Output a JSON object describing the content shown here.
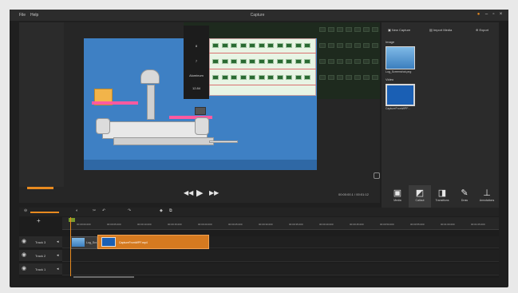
{
  "window": {
    "title": "Capture",
    "menu": [
      "File",
      "Help"
    ]
  },
  "preview": {
    "info_panel": [
      "8",
      "7",
      "Aluminum",
      "12.84"
    ],
    "timecode": "00:00:00.1 / 00:01:12"
  },
  "right_panel": {
    "tabs": [
      "New Capture",
      "Import Media",
      "Export"
    ],
    "sections": {
      "image_label": "Image",
      "image_caption": "Log_Screenshot.png",
      "video_label": "Video",
      "video_caption": "CaptureFromWPF..."
    },
    "tools": [
      {
        "label": "Media",
        "icon": "media-icon"
      },
      {
        "label": "Callout",
        "icon": "callout-icon"
      },
      {
        "label": "Transitions",
        "icon": "transitions-icon"
      },
      {
        "label": "Draw",
        "icon": "pen-icon"
      },
      {
        "label": "Annotations",
        "icon": "person-icon"
      }
    ]
  },
  "timeline": {
    "ruler": [
      "00:00:00.000",
      "00:00:05.000",
      "00:00:10.000",
      "00:00:15.000",
      "00:00:20.000",
      "00:00:25.000",
      "00:00:30.000",
      "00:00:35.000",
      "00:00:40.000",
      "00:00:45.000",
      "00:00:50.000",
      "00:00:55.000",
      "00:01:00.000",
      "00:01:05.000"
    ],
    "tracks": [
      "Track 3",
      "Track 2",
      "Track 1"
    ],
    "clips": {
      "image_clip": "Log_Scr...",
      "video_clip": "CaptureFromWPF.mp4"
    }
  },
  "colors": {
    "accent": "#e88a1f",
    "panel": "#2b2b2b",
    "clip": "#d57a20",
    "scene_blue": "#3e80c4"
  }
}
